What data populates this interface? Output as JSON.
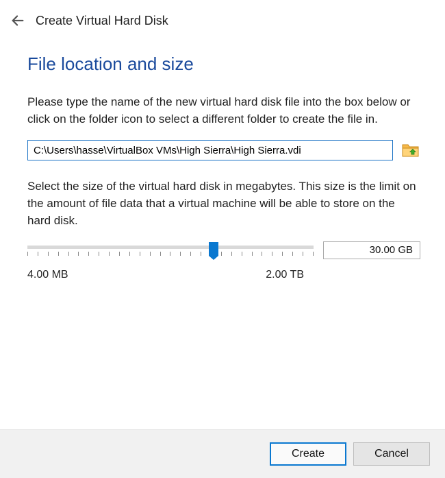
{
  "header": {
    "title": "Create Virtual Hard Disk"
  },
  "section": {
    "heading": "File location and size",
    "path_instructions": "Please type the name of the new virtual hard disk file into the box below or click on the folder icon to select a different folder to create the file in.",
    "path_value": "C:\\Users\\hasse\\VirtualBox VMs\\High Sierra\\High Sierra.vdi",
    "size_instructions": "Select the size of the virtual hard disk in megabytes. This size is the limit on the amount of file data that a virtual machine will be able to store on the hard disk.",
    "size_display": "30.00 GB",
    "range_min": "4.00 MB",
    "range_max": "2.00 TB",
    "slider_percent": 65
  },
  "footer": {
    "create_label": "Create",
    "cancel_label": "Cancel"
  }
}
